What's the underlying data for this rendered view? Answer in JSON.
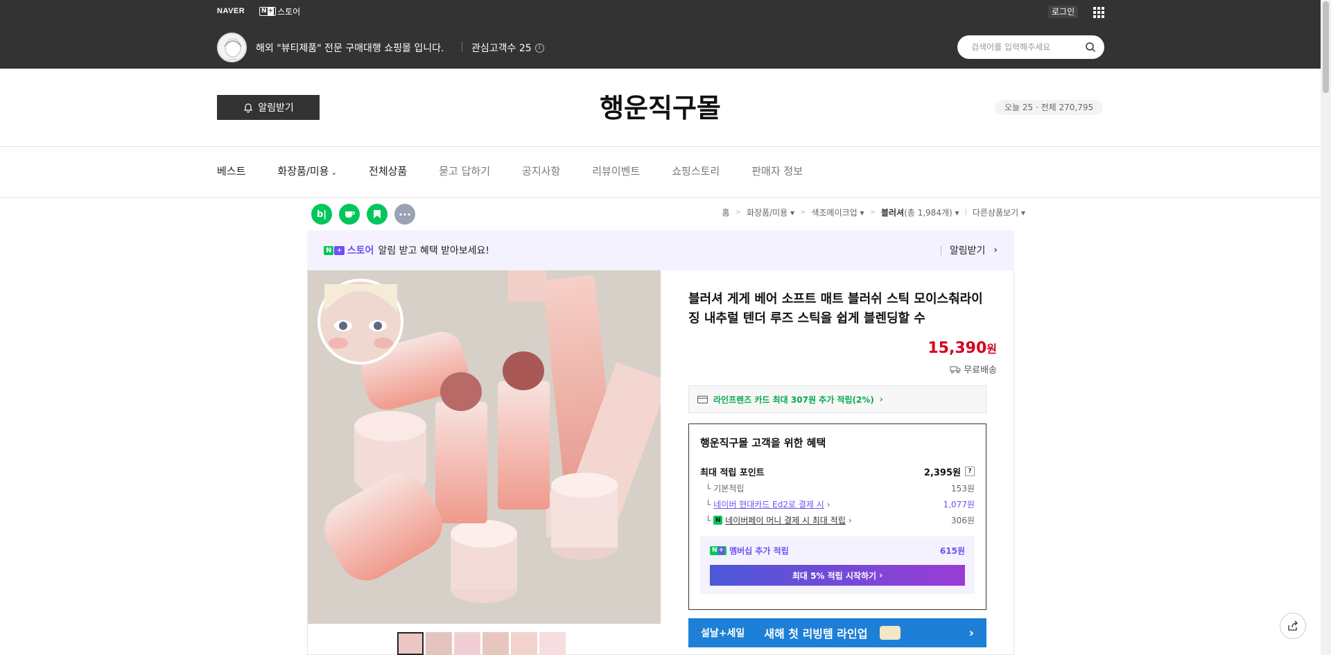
{
  "header": {
    "naver": "NAVER",
    "store_badge": "N+",
    "store_label": "스토어",
    "login": "로그인",
    "store_desc": "해외 \"뷰티제품\" 전문 구매대행 쇼핑몰 입니다.",
    "interest": "관심고객수 25",
    "search_placeholder": "검색어를 입력해주세요"
  },
  "store": {
    "alarm": "알림받기",
    "title": "행운직구몰",
    "visitor_today": "오늘 25",
    "visitor_total": "전체 270,795"
  },
  "nav": [
    "베스트",
    "화장품/미용",
    "전체상품",
    "묻고 답하기",
    "공지사항",
    "리뷰이벤트",
    "쇼핑스토리",
    "판매자 정보"
  ],
  "share_icons": [
    "blog-icon",
    "cafe-icon",
    "band-icon",
    "more-icon"
  ],
  "breadcrumb": {
    "home": "홈",
    "cat1": "화장품/미용",
    "cat2": "색조메이크업",
    "cat3": "블러셔",
    "count": "(총 1,984개)",
    "other": "다른상품보기"
  },
  "banner": {
    "store": "스토어",
    "text": "알림 받고 혜택 받아보세요!",
    "action": "알림받기"
  },
  "product": {
    "name": "블러셔 게게 베어 소프트 매트 블러쉬 스틱 모이스춰라이징 내추럴 텐더 루즈 스틱을 쉽게 블렌딩할 수",
    "price": "15,390",
    "currency": "원",
    "delivery": "무료배송",
    "card": "라인프렌즈 카드 최대 307원 추가 적립(2%)"
  },
  "benefit": {
    "title": "행운직구몰 고객을 위한 혜택",
    "max_label": "최대 적립 포인트",
    "max_value": "2,395원",
    "basic_label": "기본적립",
    "basic_value": "153원",
    "card_label": "네이버 현대카드 Ed2로 결제 시",
    "card_value": "1,077원",
    "money_label": "네이버페이 머니 결제 시 최대 적립",
    "money_value": "306원",
    "member_label": "멤버십 추가 적립",
    "member_value": "615원",
    "start_btn": "최대 5% 적립 시작하기"
  },
  "event": {
    "left": "설날+세일",
    "text": "새해 첫 리빙템 라인업"
  },
  "colors": {
    "accent": "#6f4ef6",
    "green": "#03c75a",
    "price": "#d6001c"
  }
}
